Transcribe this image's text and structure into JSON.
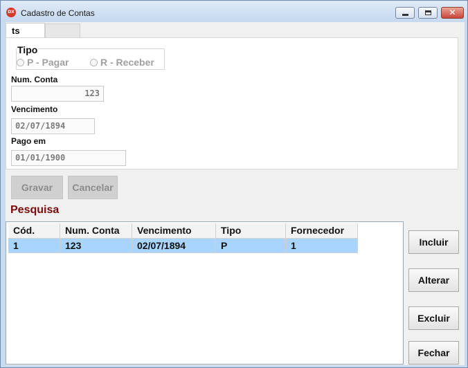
{
  "window": {
    "title": "Cadastro de Contas",
    "app_icon_text": "DX"
  },
  "tabs": [
    {
      "label": "ts",
      "selected": true
    },
    {
      "label": "",
      "selected": false
    }
  ],
  "form": {
    "tipo": {
      "title": "Tipo",
      "options": [
        {
          "label": "P - Pagar",
          "checked": false
        },
        {
          "label": "R - Receber",
          "checked": false
        }
      ]
    },
    "num_conta": {
      "label": "Num. Conta",
      "value": "123"
    },
    "vencimento": {
      "label": "Vencimento",
      "value": "02/07/1894"
    },
    "pago_em": {
      "label": "Pago em",
      "value": "01/01/1900"
    }
  },
  "actions": {
    "gravar": "Gravar",
    "cancelar": "Cancelar"
  },
  "pesquisa": {
    "title": "Pesquisa",
    "columns": [
      "Cód.",
      "Num. Conta",
      "Vencimento",
      "Tipo",
      "Fornecedor"
    ],
    "rows": [
      [
        "1",
        "123",
        "02/07/1894",
        "P",
        "1"
      ]
    ]
  },
  "side_buttons": {
    "incluir": "Incluir",
    "alterar": "Alterar",
    "excluir": "Excluir",
    "fechar": "Fechar"
  },
  "colors": {
    "selected_row": "#a9d4fb",
    "pesquisa_title": "#7a0b0b"
  }
}
